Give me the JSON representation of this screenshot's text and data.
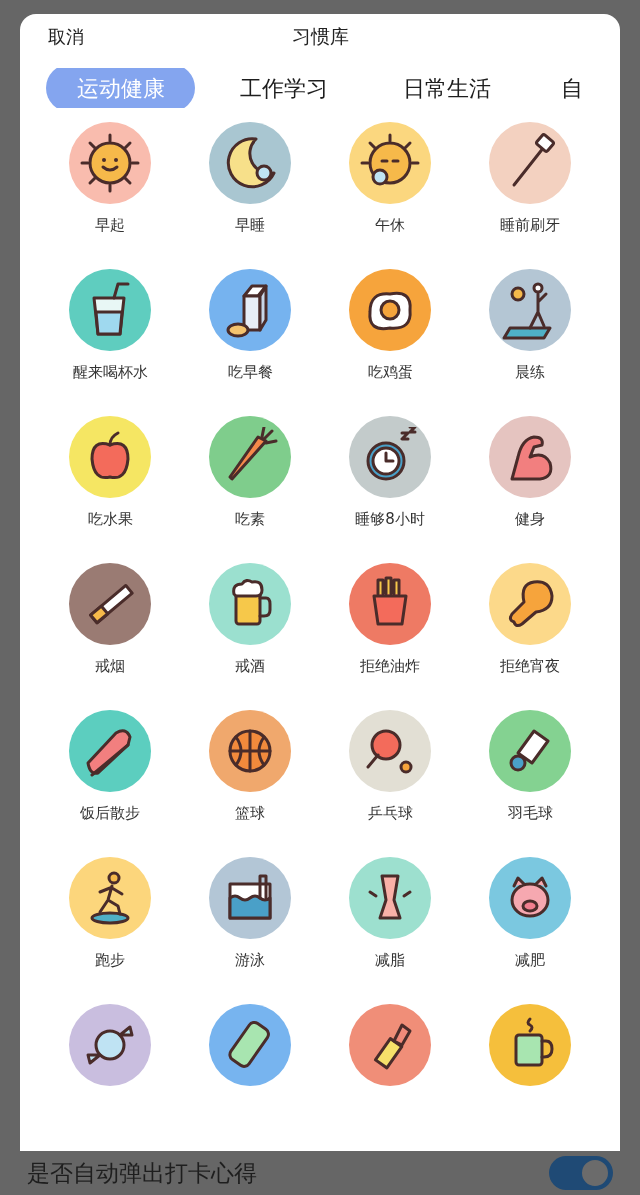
{
  "header": {
    "cancel": "取消",
    "title": "习惯库"
  },
  "tabs": [
    {
      "label": "运动健康",
      "selected": true
    },
    {
      "label": "工作学习",
      "selected": false
    },
    {
      "label": "日常生活",
      "selected": false
    },
    {
      "label": "自",
      "selected": false
    }
  ],
  "habits": [
    {
      "label": "早起",
      "color": "#f9bcae"
    },
    {
      "label": "早睡",
      "color": "#a9c6d1"
    },
    {
      "label": "午休",
      "color": "#fbd77f"
    },
    {
      "label": "睡前刷牙",
      "color": "#f3d1c0"
    },
    {
      "label": "醒来喝杯水",
      "color": "#5fcdbf"
    },
    {
      "label": "吃早餐",
      "color": "#76b3ef"
    },
    {
      "label": "吃鸡蛋",
      "color": "#f6a43c"
    },
    {
      "label": "晨练",
      "color": "#b4c6d4"
    },
    {
      "label": "吃水果",
      "color": "#f5e663"
    },
    {
      "label": "吃素",
      "color": "#7fcd8c"
    },
    {
      "label": "睡够8小时",
      "color": "#c3cbcb"
    },
    {
      "label": "健身",
      "color": "#e5c4c0"
    },
    {
      "label": "戒烟",
      "color": "#9a7b73"
    },
    {
      "label": "戒酒",
      "color": "#9be0cf"
    },
    {
      "label": "拒绝油炸",
      "color": "#ee7a64"
    },
    {
      "label": "拒绝宵夜",
      "color": "#fcd98a"
    },
    {
      "label": "饭后散步",
      "color": "#5ccebf"
    },
    {
      "label": "篮球",
      "color": "#f0a86d"
    },
    {
      "label": "乒乓球",
      "color": "#e2dfd4"
    },
    {
      "label": "羽毛球",
      "color": "#84d291"
    },
    {
      "label": "跑步",
      "color": "#fcd67c"
    },
    {
      "label": "游泳",
      "color": "#b3c6d6"
    },
    {
      "label": "减脂",
      "color": "#9de0cf"
    },
    {
      "label": "减肥",
      "color": "#7bc8e0"
    },
    {
      "color": "#c9bedf"
    },
    {
      "color": "#77b4ef"
    },
    {
      "color": "#f08e78"
    },
    {
      "color": "#f5bf3c"
    }
  ],
  "bottom_setting": {
    "label": "是否自动弹出打卡心得",
    "on": true
  }
}
